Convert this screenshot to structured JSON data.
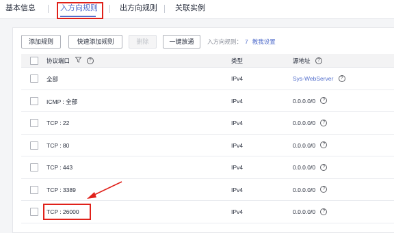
{
  "tabs": [
    {
      "label": "基本信息"
    },
    {
      "label": "入方向规则",
      "active": true
    },
    {
      "label": "出方向规则"
    },
    {
      "label": "关联实例"
    }
  ],
  "toolbar": {
    "add_rule": "添加规则",
    "quick_add_rule": "快速添加规则",
    "delete": "删除",
    "one_click_allow": "一键放通",
    "rule_count_label": "入方向规则：",
    "rule_count": "7",
    "teach_link": "教我设置"
  },
  "table": {
    "headers": {
      "protocol_port": "协议端口",
      "type": "类型",
      "source": "源地址"
    },
    "rows": [
      {
        "protocol_port": "全部",
        "type": "IPv4",
        "source": "Sys-WebServer",
        "source_is_link": true
      },
      {
        "protocol_port": "ICMP : 全部",
        "type": "IPv4",
        "source": "0.0.0.0/0"
      },
      {
        "protocol_port": "TCP : 22",
        "type": "IPv4",
        "source": "0.0.0.0/0"
      },
      {
        "protocol_port": "TCP : 80",
        "type": "IPv4",
        "source": "0.0.0.0/0"
      },
      {
        "protocol_port": "TCP : 443",
        "type": "IPv4",
        "source": "0.0.0.0/0"
      },
      {
        "protocol_port": "TCP : 3389",
        "type": "IPv4",
        "source": "0.0.0.0/0"
      },
      {
        "protocol_port": "TCP : 26000",
        "type": "IPv4",
        "source": "0.0.0.0/0",
        "highlighted": true
      }
    ]
  },
  "colors": {
    "accent": "#526ecc",
    "annotation": "#e0211a"
  },
  "icons": {
    "filter": "filter-icon",
    "help": "question-circle-icon"
  }
}
